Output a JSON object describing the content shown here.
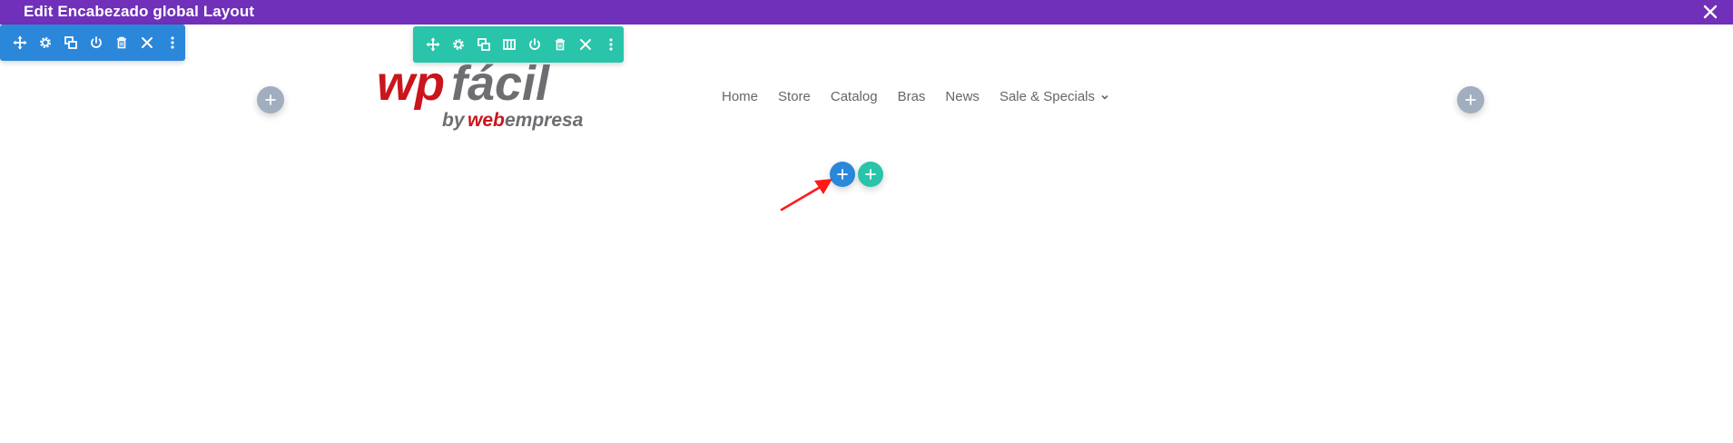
{
  "window": {
    "title": "Edit Encabezado global Layout",
    "close_icon": "close-icon",
    "bar_color": "#7030b9"
  },
  "section_toolbar": {
    "color": "#2b87da",
    "icons": [
      "move-icon",
      "gear-icon",
      "duplicate-icon",
      "power-icon",
      "trash-icon",
      "close-icon",
      "more-icon"
    ]
  },
  "row_toolbar": {
    "color": "#29c4a9",
    "icons": [
      "move-icon",
      "gear-icon",
      "duplicate-icon",
      "columns-icon",
      "power-icon",
      "trash-icon",
      "close-icon",
      "more-icon"
    ]
  },
  "logo": {
    "wp": "wp",
    "facil": "fácil",
    "by": "by",
    "web": "web",
    "empresa": "empresa"
  },
  "nav": {
    "items": [
      "Home",
      "Store",
      "Catalog",
      "Bras",
      "News",
      "Sale & Specials"
    ]
  },
  "add_buttons": {
    "icon": "plus-icon",
    "gray_color": "#a0aebf",
    "blue_color": "#2b87da",
    "teal_color": "#29c4a9"
  },
  "annotation": {
    "arrow_color": "#ff1a1a"
  }
}
